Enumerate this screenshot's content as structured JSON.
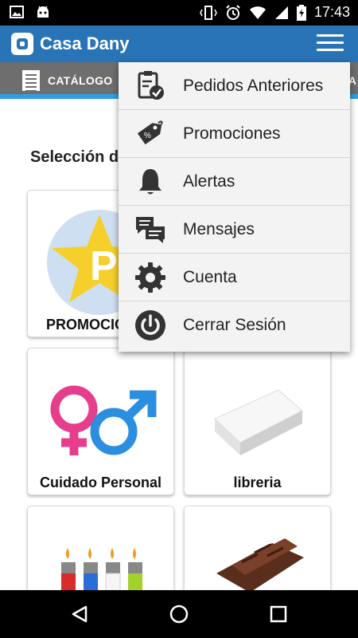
{
  "status_bar": {
    "time": "17:43"
  },
  "app_bar": {
    "title": "Casa Dany"
  },
  "tabs": {
    "active_label": "CATÁLOGO",
    "overflow_text": "A"
  },
  "content": {
    "section_title": "Selección de",
    "cards": [
      {
        "label": "PROMOCIONES",
        "icon": "promo-star-icon"
      },
      {
        "label": "Cuidado Personal",
        "icon": "gender-symbols-icon"
      },
      {
        "label": "libreria",
        "icon": "paper-stack-icon"
      },
      {
        "label": "",
        "icon": "lighters-icon"
      },
      {
        "label": "",
        "icon": "chocolate-icon"
      }
    ]
  },
  "menu": {
    "items": [
      {
        "label": "Pedidos Anteriores",
        "icon": "clipboard-check-icon"
      },
      {
        "label": "Promociones",
        "icon": "price-tag-icon"
      },
      {
        "label": "Alertas",
        "icon": "bell-icon"
      },
      {
        "label": "Mensajes",
        "icon": "chat-bubbles-icon"
      },
      {
        "label": "Cuenta",
        "icon": "gear-icon"
      },
      {
        "label": "Cerrar Sesión",
        "icon": "power-icon"
      }
    ]
  },
  "colors": {
    "app_bar": "#2874b7",
    "tab_bar": "#6e6e6e",
    "tab_indicator": "#2e9fe0",
    "menu_bg": "#f3f3f3"
  }
}
